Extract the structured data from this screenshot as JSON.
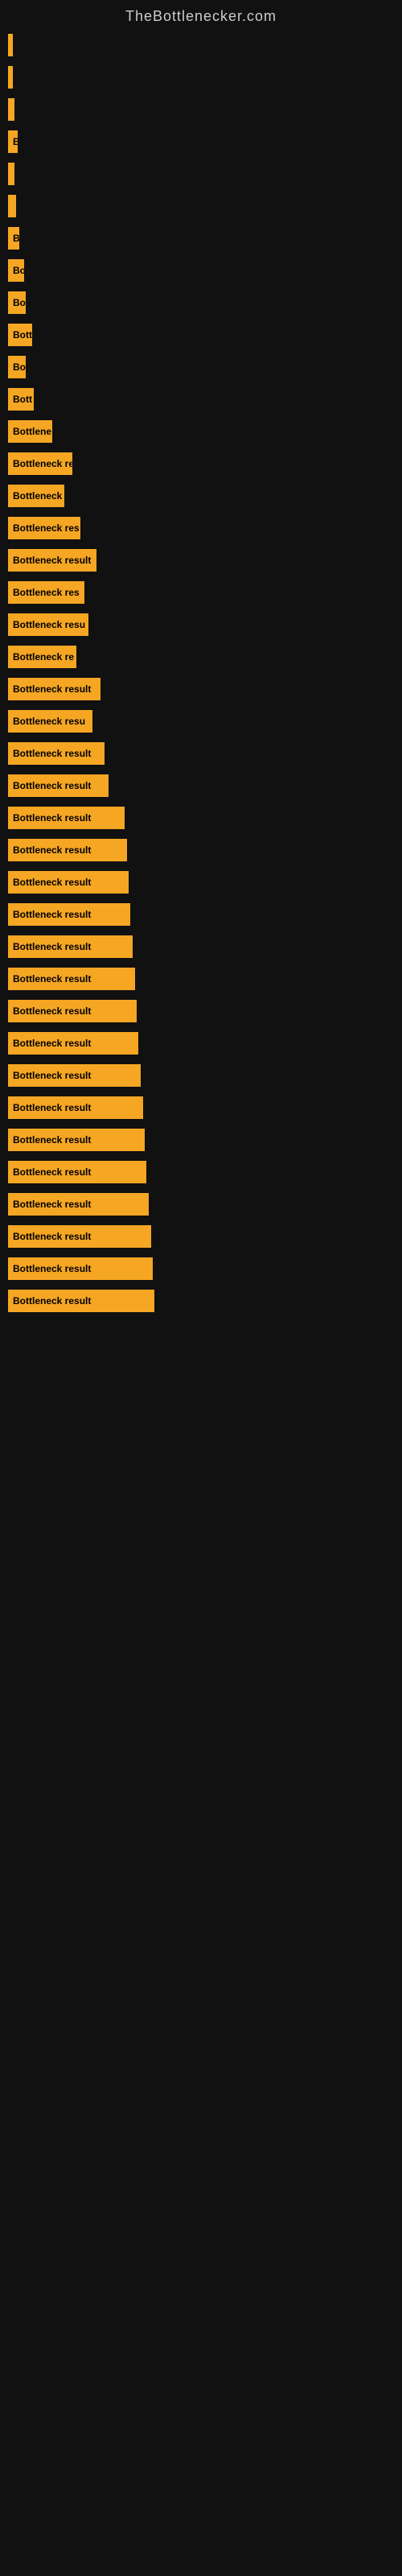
{
  "site_title": "TheBottlenecker.com",
  "bars": [
    {
      "label": "",
      "width": 4,
      "visible_text": ""
    },
    {
      "label": "",
      "width": 6,
      "visible_text": ""
    },
    {
      "label": "",
      "width": 8,
      "visible_text": ""
    },
    {
      "label": "B",
      "width": 12,
      "visible_text": "B"
    },
    {
      "label": "",
      "width": 8,
      "visible_text": ""
    },
    {
      "label": "",
      "width": 10,
      "visible_text": ""
    },
    {
      "label": "B",
      "width": 14,
      "visible_text": "B"
    },
    {
      "label": "Bo",
      "width": 20,
      "visible_text": "Bo"
    },
    {
      "label": "Bo",
      "width": 22,
      "visible_text": "Bo"
    },
    {
      "label": "Bott",
      "width": 30,
      "visible_text": "Bott"
    },
    {
      "label": "Bo",
      "width": 22,
      "visible_text": "Bo"
    },
    {
      "label": "Bott",
      "width": 32,
      "visible_text": "Bott"
    },
    {
      "label": "Bottlene",
      "width": 55,
      "visible_text": "Bottlene"
    },
    {
      "label": "Bottleneck re",
      "width": 80,
      "visible_text": "Bottleneck re"
    },
    {
      "label": "Bottleneck",
      "width": 70,
      "visible_text": "Bottleneck"
    },
    {
      "label": "Bottleneck res",
      "width": 90,
      "visible_text": "Bottleneck res"
    },
    {
      "label": "Bottleneck result",
      "width": 110,
      "visible_text": "Bottleneck result"
    },
    {
      "label": "Bottleneck res",
      "width": 95,
      "visible_text": "Bottleneck res"
    },
    {
      "label": "Bottleneck resu",
      "width": 100,
      "visible_text": "Bottleneck resu"
    },
    {
      "label": "Bottleneck re",
      "width": 85,
      "visible_text": "Bottleneck re"
    },
    {
      "label": "Bottleneck result",
      "width": 115,
      "visible_text": "Bottleneck result"
    },
    {
      "label": "Bottleneck resu",
      "width": 105,
      "visible_text": "Bottleneck resu"
    },
    {
      "label": "Bottleneck result",
      "width": 120,
      "visible_text": "Bottleneck result"
    },
    {
      "label": "Bottleneck result",
      "width": 125,
      "visible_text": "Bottleneck result"
    },
    {
      "label": "Bottleneck result",
      "width": 145,
      "visible_text": "Bottleneck result"
    },
    {
      "label": "Bottleneck result",
      "width": 148,
      "visible_text": "Bottleneck result"
    },
    {
      "label": "Bottleneck result",
      "width": 150,
      "visible_text": "Bottleneck result"
    },
    {
      "label": "Bottleneck result",
      "width": 152,
      "visible_text": "Bottleneck result"
    },
    {
      "label": "Bottleneck result",
      "width": 155,
      "visible_text": "Bottleneck result"
    },
    {
      "label": "Bottleneck result",
      "width": 158,
      "visible_text": "Bottleneck result"
    },
    {
      "label": "Bottleneck result",
      "width": 160,
      "visible_text": "Bottleneck result"
    },
    {
      "label": "Bottleneck result",
      "width": 162,
      "visible_text": "Bottleneck result"
    },
    {
      "label": "Bottleneck result",
      "width": 165,
      "visible_text": "Bottleneck result"
    },
    {
      "label": "Bottleneck result",
      "width": 168,
      "visible_text": "Bottleneck result"
    },
    {
      "label": "Bottleneck result",
      "width": 170,
      "visible_text": "Bottleneck result"
    },
    {
      "label": "Bottleneck result",
      "width": 172,
      "visible_text": "Bottleneck result"
    },
    {
      "label": "Bottleneck result",
      "width": 175,
      "visible_text": "Bottleneck result"
    },
    {
      "label": "Bottleneck result",
      "width": 178,
      "visible_text": "Bottleneck result"
    },
    {
      "label": "Bottleneck result",
      "width": 180,
      "visible_text": "Bottleneck result"
    },
    {
      "label": "Bottleneck result",
      "width": 182,
      "visible_text": "Bottleneck result"
    }
  ]
}
